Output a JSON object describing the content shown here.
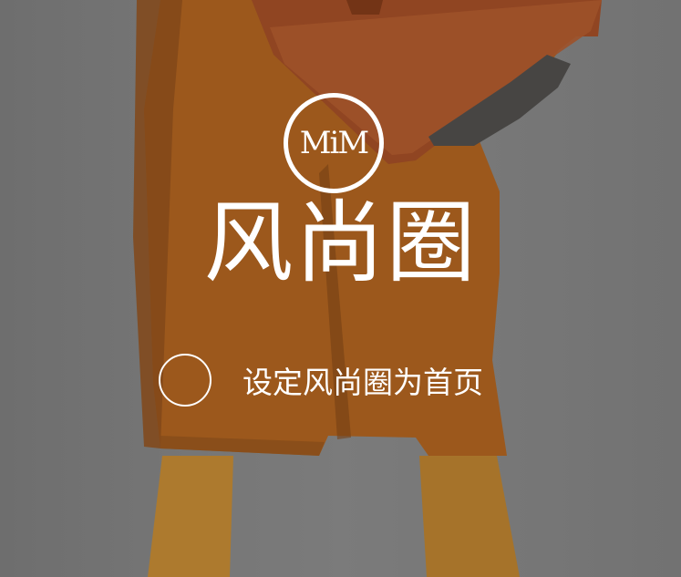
{
  "app": {
    "logo_text": "MiM",
    "title": "风尚圈"
  },
  "homepage_option": {
    "label": "设定风尚圈为首页",
    "checked": false
  },
  "colors": {
    "coat": "#a35d1f",
    "bag": "#9c4a23",
    "overlay_text": "#ffffff",
    "background": "#7e7e7e"
  }
}
